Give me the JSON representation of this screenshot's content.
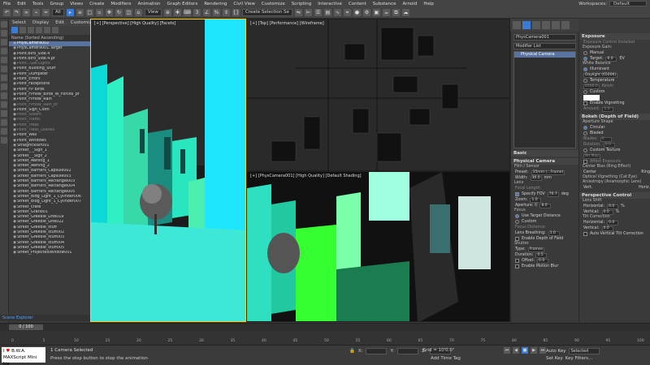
{
  "menubar": {
    "items": [
      "File",
      "Edit",
      "Tools",
      "Group",
      "Views",
      "Create",
      "Modifiers",
      "Animation",
      "Graph Editors",
      "Rendering",
      "Civil View",
      "Customize",
      "Scripting",
      "Interactive",
      "Content",
      "Substance",
      "Arnold",
      "Help"
    ],
    "workspaces_label": "Workspaces:",
    "workspace_value": "Default"
  },
  "toolbar": {
    "view_dropdown": "View",
    "selection_set": "Create Selection Se"
  },
  "scene_explorer": {
    "menu": [
      "Select",
      "Display",
      "Edit",
      "Customize"
    ],
    "header": "Name (Sorted Ascending)",
    "items": [
      {
        "name": "PhysCamera002",
        "sel": true,
        "dim": false
      },
      {
        "name": "PhysCamera001.Target",
        "sel": false,
        "dim": false
      },
      {
        "name": "Point.Bird_Side.4",
        "sel": false,
        "dim": false
      },
      {
        "name": "Point.Bird_Side.4.pf",
        "sel": false,
        "dim": false
      },
      {
        "name": "Point...Ger.Lights",
        "sel": false,
        "dim": true
      },
      {
        "name": "Point_Building_Stuff",
        "sel": false,
        "dim": false
      },
      {
        "name": "Point_Dumpster",
        "sel": false,
        "dim": false
      },
      {
        "name": "Point_Errors",
        "sel": false,
        "dim": false
      },
      {
        "name": "Point_Facephone",
        "sel": false,
        "dim": false
      },
      {
        "name": "Point_FP Birds",
        "sel": false,
        "dim": false
      },
      {
        "name": "Point_FPflow_Birds_W_Forces_pf",
        "sel": false,
        "dim": false
      },
      {
        "name": "Point_FPflow_Rain",
        "sel": false,
        "dim": false
      },
      {
        "name": "Point_FPflow_Rain_pf",
        "sel": false,
        "dim": true
      },
      {
        "name": "Point_Sign_Cloth",
        "sel": false,
        "dim": false
      },
      {
        "name": "Point_Steam",
        "sel": false,
        "dim": true
      },
      {
        "name": "Point_Traffic",
        "sel": false,
        "dim": true
      },
      {
        "name": "Point_Trees",
        "sel": false,
        "dim": true
      },
      {
        "name": "Point_Trees_Leaves",
        "sel": false,
        "dim": true
      },
      {
        "name": "Point_Wall",
        "sel": false,
        "dim": false
      },
      {
        "name": "Point_Windows",
        "sel": false,
        "dim": false
      },
      {
        "name": "StraightStair001",
        "sel": false,
        "dim": false
      },
      {
        "name": "Street_ _Sign_1",
        "sel": false,
        "dim": false
      },
      {
        "name": "Street_ _Sign_2",
        "sel": false,
        "dim": false
      },
      {
        "name": "Street_Awning_1",
        "sel": false,
        "dim": false
      },
      {
        "name": "Street_Awning_2",
        "sel": false,
        "dim": false
      },
      {
        "name": "Street_Barriers_Capsule002",
        "sel": false,
        "dim": false
      },
      {
        "name": "Street_Barriers_Capsule003",
        "sel": false,
        "dim": false
      },
      {
        "name": "Street_Barriers_Rectangle003",
        "sel": false,
        "dim": false
      },
      {
        "name": "Street_Barriers_Rectangle004",
        "sel": false,
        "dim": false
      },
      {
        "name": "Street_Barriers_Rectangle005",
        "sel": false,
        "dim": false
      },
      {
        "name": "Street_Bldg_Light_1_Cylinder006",
        "sel": false,
        "dim": false
      },
      {
        "name": "Street_Bldg_Light_1_Cylinder007",
        "sel": false,
        "dim": false
      },
      {
        "name": "Street_crate",
        "sel": false,
        "dim": false
      },
      {
        "name": "Street_Gratio01",
        "sel": false,
        "dim": false
      },
      {
        "name": "Street_Greeble_Line019",
        "sel": false,
        "dim": false
      },
      {
        "name": "Street_Greeble_Line022",
        "sel": false,
        "dim": false
      },
      {
        "name": "Street_Greeble_stuff",
        "sel": false,
        "dim": false
      },
      {
        "name": "Street_Greeble_stuff002",
        "sel": false,
        "dim": false
      },
      {
        "name": "Street_Greeble_stuff003",
        "sel": false,
        "dim": false
      },
      {
        "name": "Street_Greeble_stuff004",
        "sel": false,
        "dim": false
      },
      {
        "name": "Street_Greeble_stuff005",
        "sel": false,
        "dim": false
      },
      {
        "name": "Street_ProjectedWindow001",
        "sel": false,
        "dim": false
      }
    ],
    "footer": "Scene Explorer"
  },
  "viewports": {
    "top_left": "[+] [Perspective] [High Quality] [Facets]",
    "top_right": "[+] [Top] [Performance] [Wireframe]",
    "bottom_right": "[+] [PhysCamera001] [High Quality] [Default Shading]"
  },
  "modify_panel": {
    "object_name": "PhysCamera001",
    "modifier_list": "Modifier List",
    "stack_item": "Physical Camera",
    "basic": "Basic",
    "physical_camera": "Physical Camera",
    "film_sensor": "Film / Sensor",
    "preset_label": "Preset:",
    "preset_value": "35mm (...Frame)",
    "width_label": "Width:",
    "width_value": "36.0",
    "width_unit": "mm",
    "lens": "Lens",
    "focal_label": "Focal Length:",
    "specify_fov": "Specify FOV",
    "fov_value": "76.7",
    "fov_unit": "deg",
    "zoom_label": "Zoom:",
    "zoom_value": "1.0",
    "aperture_label": "Aperture: f/",
    "aperture_value": "8.0",
    "focus": "Focus",
    "use_target": "Use Target Distance",
    "custom": "Custom",
    "focus_distance": "Focus Distance:",
    "lens_breathing_label": "Lens Breathing:",
    "lens_breathing_value": "1.0",
    "enable_dof": "Enable Depth of Field",
    "shutter": "Shutter",
    "type_label": "Type:",
    "type_value": "Frames",
    "duration_label": "Duration:",
    "duration_value": "0.5",
    "offset_label": "Offset:",
    "offset_value": "0.0",
    "enable_motion_blur": "Enable Motion Blur"
  },
  "right_panel": {
    "exposure": "Exposure",
    "exposure_control": "Exposure Control Installed",
    "exposure_gain": "Exposure Gain:",
    "manual": "Manual",
    "target": "Target:",
    "target_value": "6.0",
    "target_unit": "EV",
    "white_balance": "White Balance",
    "illuminant": "Illuminant",
    "illuminant_value": "Daylight (6500K)",
    "temperature": "Temperature",
    "temperature_value": "6500.0",
    "temperature_unit": "Kelvin",
    "custom": "Custom",
    "enable_vignetting": "Enable Vignetting",
    "amount_label": "Amount:",
    "amount_value": "1.0",
    "bokeh": "Bokeh (Depth of Field)",
    "aperture_shape": "Aperture Shape",
    "circular": "Circular",
    "bladed": "Bladed",
    "blades_label": "Blades:",
    "blades_value": "6",
    "rotation_label": "Rotation:",
    "rotation_value": "0.0",
    "custom_texture": "Custom Texture",
    "no_map": "No Map",
    "affect_exposure": "Affect Exposure",
    "center_bias": "Center Bias (Ring Effect)",
    "center": "Center",
    "ring": "Ring",
    "optical_vignetting": "Optical Vignetting (Cat Eye)",
    "anisotropy": "Anisotropy (Anamorphic Lens)",
    "vert": "Vert.",
    "horiz": "Horiz.",
    "perspective_control": "Perspective Control",
    "lens_shift": "Lens Shift",
    "horizontal": "Horizontal:",
    "horizontal_value": "0.0",
    "vertical": "Vertical:",
    "vertical_value": "0.0",
    "tilt_correction": "Tilt Correction",
    "horizontal2": "Horizontal:",
    "horizontal2_value": "0.0",
    "vertical2": "Vertical:",
    "vertical2_value": "0.0",
    "auto_vertical": "Auto Vertical Tilt Correction",
    "pct": "%"
  },
  "timeline": {
    "slider": "0 / 100",
    "ticks": [
      "0",
      "5",
      "10",
      "15",
      "20",
      "25",
      "30",
      "35",
      "40",
      "45",
      "50",
      "55",
      "60",
      "65",
      "70",
      "75",
      "80",
      "85",
      "90",
      "95",
      "100"
    ]
  },
  "status": {
    "maxscript_prefix": "I",
    "maxscript_heart": "♥",
    "maxscript_name": "B.W.A.",
    "maxscript_sub": "MAXScript Mini Lis",
    "selected": "1 Camera Selected",
    "hint": "Press the stop button to stop the animation",
    "grid": "Grid = 10'0.0\"",
    "add_time_tag": "Add Time Tag",
    "auto_key": "Auto Key",
    "selected_dd": "Selected",
    "set_key": "Set Key",
    "key_filters": "Key Filters..."
  },
  "colors": {
    "accent": "#3a7bd5",
    "selection": "#5873a0",
    "active_viewport": "#ffd200"
  }
}
